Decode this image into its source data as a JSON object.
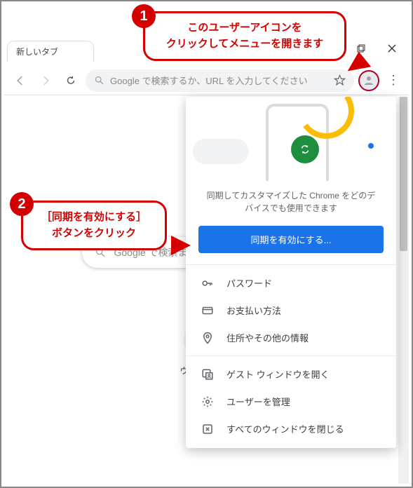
{
  "window": {
    "tab_title": "新しいタブ"
  },
  "omnibox": {
    "placeholder": "Google で検索するか、URL を入力してください"
  },
  "ntp": {
    "search_placeholder": "Google で検索または",
    "shortcut_label": "ウェブスト"
  },
  "profile_menu": {
    "description": "同期してカスタマイズした Chrome をどのデバイスでも使用できます",
    "sync_button": "同期を有効にする...",
    "items_top": [
      {
        "icon": "key",
        "label": "パスワード"
      },
      {
        "icon": "card",
        "label": "お支払い方法"
      },
      {
        "icon": "pin",
        "label": "住所やその他の情報"
      }
    ],
    "items_bottom": [
      {
        "icon": "guest",
        "label": "ゲスト ウィンドウを開く"
      },
      {
        "icon": "gear",
        "label": "ユーザーを管理"
      },
      {
        "icon": "closeall",
        "label": "すべてのウィンドウを閉じる"
      }
    ]
  },
  "callouts": {
    "c1_line1": "このユーザーアイコンを",
    "c1_line2": "クリックしてメニューを開きます",
    "c2_line1": "［同期を有効にする］",
    "c2_line2": "ボタンをクリック"
  }
}
